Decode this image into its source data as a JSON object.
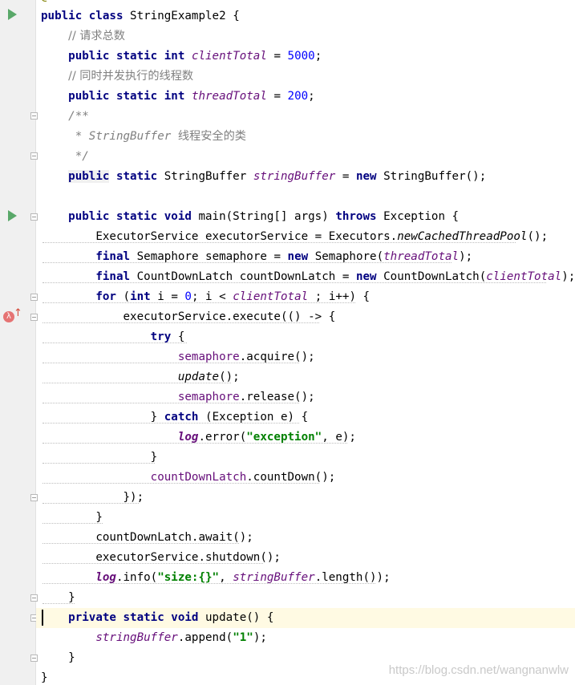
{
  "editor": {
    "top_annotation": "@ThreadSafe",
    "lines": {
      "l1": {
        "kw": "public class",
        "name": "StringExample2",
        "brace": "{"
      },
      "l2": {
        "comment": "// 请求总数"
      },
      "l3": {
        "kw": "public static int",
        "field": "clientTotal",
        "eq": "=",
        "value": "5000",
        "semi": ";"
      },
      "l4": {
        "comment": "// 同时并发执行的线程数"
      },
      "l5": {
        "kw": "public static int",
        "field": "threadTotal",
        "eq": "=",
        "value": "200",
        "semi": ";"
      },
      "l6": {
        "comment": "/**"
      },
      "l7": {
        "comment_a": "* StringBuffer",
        "comment_b": "线程安全的类"
      },
      "l8": {
        "comment": "*/"
      },
      "l9": {
        "kw1": "public",
        "kw2": "static",
        "type": "StringBuffer",
        "field": "stringBuffer",
        "eq": "=",
        "kw3": "new",
        "ctor": "StringBuffer();"
      },
      "l11": {
        "kw": "public static void",
        "name": "main(String[] args)",
        "kw2": "throws",
        "rest": "Exception {"
      },
      "l12": {
        "text_a": "ExecutorService executorService = Executors.",
        "method": "newCachedThreadPool",
        "text_b": "();"
      },
      "l13": {
        "kw": "final",
        "text_a": "Semaphore semaphore =",
        "kw2": "new",
        "text_b": "Semaphore(",
        "field": "threadTotal",
        "text_c": ");"
      },
      "l14": {
        "kw": "final",
        "text_a": "CountDownLatch countDownLatch =",
        "kw2": "new",
        "text_b": "CountDownLatch(",
        "field": "clientTotal",
        "text_c": ");"
      },
      "l15": {
        "kw": "for",
        "text_a": "(",
        "kw2": "int",
        "text_b": "i =",
        "num": "0",
        "text_c": "; i <",
        "field": "clientTotal",
        "text_d": "; i++) {"
      },
      "l16": {
        "text": "executorService.execute(() -> {"
      },
      "l17": {
        "kw": "try",
        "text": "{"
      },
      "l18": {
        "var": "semaphore",
        "text": ".acquire();"
      },
      "l19": {
        "method": "update",
        "text": "();"
      },
      "l20": {
        "var": "semaphore",
        "text": ".release();"
      },
      "l21": {
        "text_a": "}",
        "kw": "catch",
        "text_b": "(Exception e) {"
      },
      "l22": {
        "field": "log",
        "text_a": ".error(",
        "str": "\"exception\"",
        "text_b": ", e);"
      },
      "l23": {
        "text": "}"
      },
      "l24": {
        "var": "countDownLatch",
        "text": ".countDown();"
      },
      "l25": {
        "text": "});"
      },
      "l26": {
        "text": "}"
      },
      "l27": {
        "text": "countDownLatch.await();"
      },
      "l28": {
        "text": "executorService.shutdown();"
      },
      "l29": {
        "field": "log",
        "text_a": ".info(",
        "str": "\"size:{}\"",
        "text_b": ",",
        "field2": "stringBuffer",
        "text_c": ".length());"
      },
      "l30": {
        "text": "}"
      },
      "l31": {
        "kw": "private static void",
        "name": "update()",
        "brace": "{"
      },
      "l32": {
        "field": "stringBuffer",
        "text_a": ".append(",
        "str": "\"1\"",
        "text_b": ");"
      },
      "l33": {
        "text": "}"
      },
      "l34": {
        "text": "}"
      }
    }
  },
  "gutter": {
    "run_icon": "run-triangle-icon",
    "fold_icon": "fold-marker-icon",
    "lambda_icon": "lambda-recursive-icon",
    "lambda_glyph": "λ",
    "arrow_glyph": "↑"
  },
  "watermark": "https://blog.csdn.net/wangnanwlw",
  "colors": {
    "keyword": "#000080",
    "number": "#0000ff",
    "comment": "#808080",
    "field": "#660e7a",
    "string": "#008000",
    "run": "#59a869",
    "current_line": "#fffae3"
  }
}
